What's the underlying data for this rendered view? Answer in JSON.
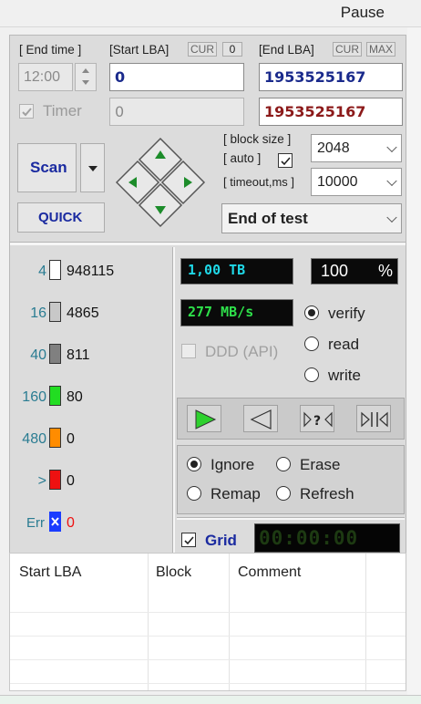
{
  "toolbar": {
    "pause_label": "Pause"
  },
  "range": {
    "end_time_label": "[ End time ]",
    "end_time_value": "12:00",
    "timer_label": "Timer",
    "start_lba_label": "[Start LBA]",
    "cur_label": "CUR",
    "cur_value": "0",
    "end_lba_label": "[End LBA]",
    "end_cur_label": "CUR",
    "max_label": "MAX",
    "start_lba_value": "0",
    "start_lba_disabled_value": "0",
    "end_lba_value": "1953525167",
    "end_lba_value2": "1953525167"
  },
  "scan": {
    "scan_label": "Scan",
    "quick_label": "QUICK",
    "block_size_label": "[ block size ]",
    "auto_label": "[ auto ]",
    "timeout_label": "[ timeout,ms ]",
    "block_size_value": "2048",
    "timeout_value": "10000",
    "end_action": "End of test"
  },
  "legend": [
    {
      "threshold": "4",
      "count": "948115",
      "color": "#ffffff"
    },
    {
      "threshold": "16",
      "count": "4865",
      "color": "#c8c8c8"
    },
    {
      "threshold": "40",
      "count": "811",
      "color": "#808080"
    },
    {
      "threshold": "160",
      "count": "80",
      "color": "#22dd22"
    },
    {
      "threshold": "480",
      "count": "0",
      "color": "#ff8c00"
    },
    {
      "threshold": ">",
      "count": "0",
      "color": "#ee1111"
    },
    {
      "threshold": "Err",
      "count": "0",
      "color": "#1a3cff"
    }
  ],
  "status": {
    "size": "1,00 TB",
    "percent": "100",
    "percent_sign": "%",
    "speed": "277 MB/s",
    "ddd_label": "DDD (API)",
    "verify_label": "verify",
    "read_label": "read",
    "write_label": "write",
    "timer_display": "00:00:00",
    "grid_label": "Grid"
  },
  "actions": {
    "ignore_label": "Ignore",
    "erase_label": "Erase",
    "remap_label": "Remap",
    "refresh_label": "Refresh"
  },
  "table": {
    "columns": [
      "Start LBA",
      "Block",
      "Comment"
    ]
  }
}
